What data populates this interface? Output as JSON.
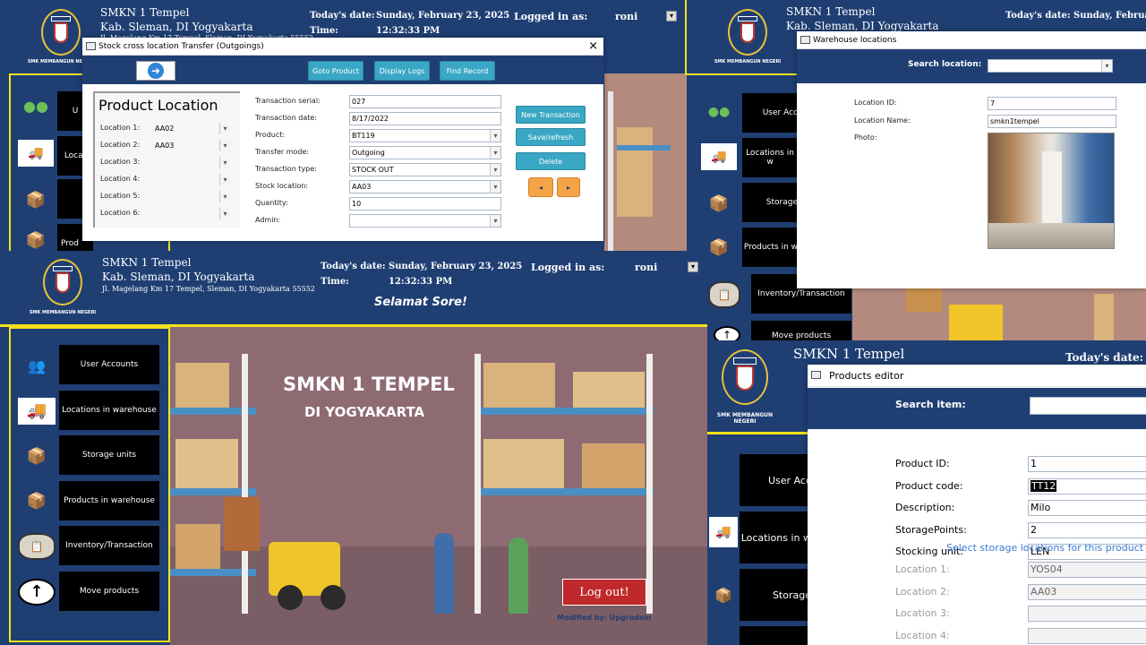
{
  "school": {
    "name": "SMKN 1 Tempel",
    "region": "Kab. Sleman, DI Yogyakarta",
    "address": "Jl. Magelang Km 17 Tempel, Sleman, DI Yogyakarta 55552",
    "address_clipped": "Jl. Magelang Km 17 Tempel, Sleman, DI Yogyakarta 55552",
    "logo_top": "SMK N 1 TEMPEL",
    "logo_caption": "SMK MEMBANGUN NEGERI"
  },
  "header": {
    "today_label": "Today's date:",
    "today_value": "Sunday, February 23, 2025",
    "today_value_clipped": "Sunday, Februar",
    "time_label": "Time:",
    "time_value": "12:32:33 PM",
    "logged_label": "Logged in as:",
    "logged_user": "roni",
    "greeting": "Selamat Sore!"
  },
  "menu": {
    "items": [
      {
        "label": "User Accounts",
        "icon": "users-icon"
      },
      {
        "label": "Locations in warehouse",
        "icon": "truck-icon"
      },
      {
        "label": "Storage units",
        "icon": "boxes-icon"
      },
      {
        "label": "Products in warehouse",
        "icon": "box-hand-icon"
      },
      {
        "label": "Inventory/Transaction",
        "icon": "clipboard-icon"
      },
      {
        "label": "Move products",
        "icon": "up-arrow-icon"
      }
    ],
    "clipped_tl": [
      "U",
      "Locat",
      "",
      "Prod"
    ],
    "clipped_tr": [
      "User Acc",
      "Locations in w",
      "Storage",
      "Products in w",
      "Inventory/Transaction",
      "Move products"
    ],
    "clipped_br": [
      "User Acc",
      "Locations in w",
      "Storage"
    ]
  },
  "banner": {
    "title": "SMKN 1 TEMPEL",
    "subtitle": "DI YOGYAKARTA",
    "logout": "Log out!",
    "credit": "Modified by: Upgradein"
  },
  "transfer_dialog": {
    "title": "Stock cross location Transfer (Outgoings)",
    "close": "×",
    "buttons": {
      "goto": "Goto Product",
      "logs": "Display Logs",
      "find": "Find Record"
    },
    "panel_title": "Product Location",
    "locations": [
      {
        "label": "Location 1:",
        "value": "AA02"
      },
      {
        "label": "Location 2:",
        "value": "AA03"
      },
      {
        "label": "Location 3:",
        "value": ""
      },
      {
        "label": "Location 4:",
        "value": ""
      },
      {
        "label": "Location 5:",
        "value": ""
      },
      {
        "label": "Location 6:",
        "value": ""
      }
    ],
    "fields": [
      {
        "label": "Transaction serial:",
        "value": "027",
        "dropdown": false
      },
      {
        "label": "Transaction date:",
        "value": "8/17/2022",
        "dropdown": false
      },
      {
        "label": "Product:",
        "value": "BT119",
        "dropdown": true
      },
      {
        "label": "Transfer mode:",
        "value": "Outgoing",
        "dropdown": true
      },
      {
        "label": "Transaction type:",
        "value": "STOCK OUT",
        "dropdown": true
      },
      {
        "label": "Stock location:",
        "value": "AA03",
        "dropdown": true
      },
      {
        "label": "Quantity:",
        "value": "10",
        "dropdown": false
      },
      {
        "label": "Admin:",
        "value": "",
        "dropdown": true
      }
    ],
    "actions": {
      "new": "New Transaction",
      "save": "Save/refresh",
      "delete": "Delete",
      "prev": "◂",
      "next": "▸"
    }
  },
  "warehouse_dialog": {
    "title": "Warehouse locations",
    "search_label": "Search location:",
    "search_value": "",
    "id_label": "Location ID:",
    "id_value": "7",
    "name_label": "Location Name:",
    "name_value": "smkn1tempel",
    "photo_label": "Photo:"
  },
  "products_dialog": {
    "title": "Products editor",
    "search_label": "Search item:",
    "fields": [
      {
        "label": "Product ID:",
        "value": "1"
      },
      {
        "label": "Product code:",
        "value": "TT12"
      },
      {
        "label": "Description:",
        "value": "Milo"
      },
      {
        "label": "StoragePoints:",
        "value": "2"
      },
      {
        "label": "Stocking unit:",
        "value": "LEN"
      }
    ],
    "hint": "Select storage locations for this product in W",
    "locations": [
      {
        "label": "Location 1:",
        "value": "YOS04"
      },
      {
        "label": "Location 2:",
        "value": "AA03"
      },
      {
        "label": "Location 3:",
        "value": ""
      },
      {
        "label": "Location 4:",
        "value": ""
      }
    ]
  },
  "colors": {
    "navy": "#1f3f73",
    "yellow": "#f5e21a",
    "teal": "#3aa7c4",
    "red": "#c0292b"
  }
}
